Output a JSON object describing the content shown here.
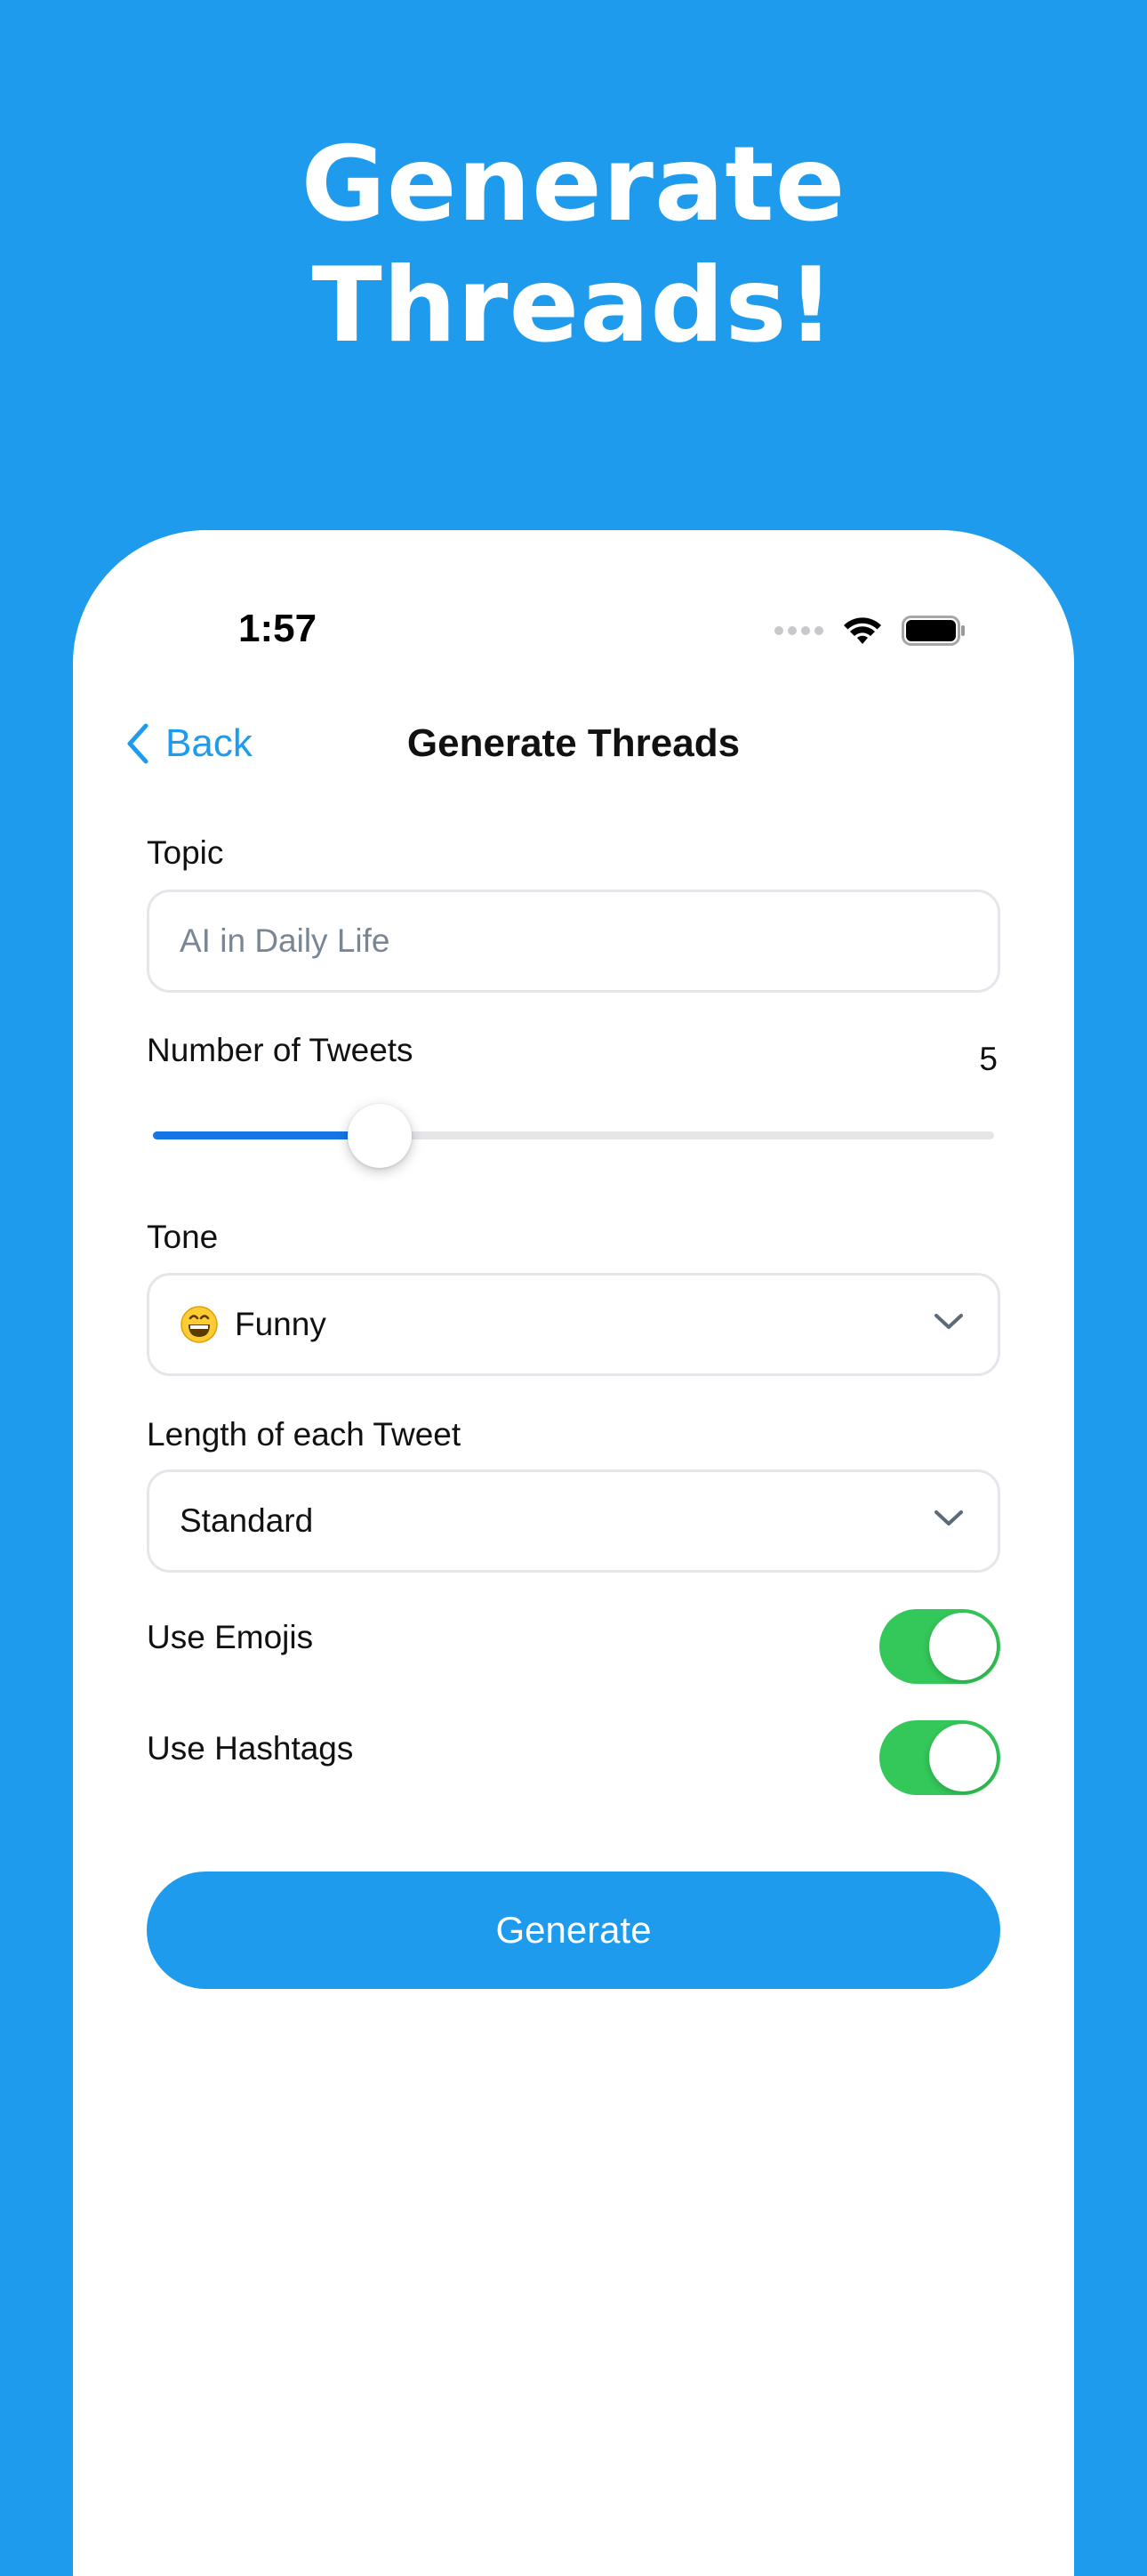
{
  "headline": {
    "line1": "Generate",
    "line2": "Threads!"
  },
  "status_bar": {
    "time": "1:57",
    "icons": [
      "signal-dots-icon",
      "wifi-icon",
      "battery-icon"
    ]
  },
  "nav": {
    "back_label": "Back",
    "back_icon": "chevron-left-icon",
    "title": "Generate Threads"
  },
  "form": {
    "topic": {
      "label": "Topic",
      "placeholder": "AI in Daily Life"
    },
    "tweets": {
      "label": "Number of Tweets",
      "value": "5",
      "slider_fraction": 0.27
    },
    "tone": {
      "label": "Tone",
      "value": "Funny",
      "icon": "grinning-face-emoji"
    },
    "length": {
      "label": "Length of each Tweet",
      "value": "Standard"
    },
    "emojis": {
      "label": "Use Emojis",
      "on": true
    },
    "hashtags": {
      "label": "Use Hashtags",
      "on": true
    },
    "generate_label": "Generate"
  },
  "colors": {
    "background": "#1F9BEE",
    "accent": "#1F9BEE",
    "slider_fill": "#1774E6",
    "toggle_on": "#34C759"
  }
}
